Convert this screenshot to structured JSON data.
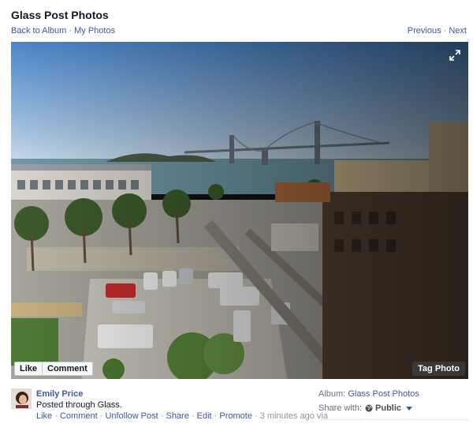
{
  "page": {
    "title": "Glass Post Photos"
  },
  "subnav": {
    "back_label": "Back to Album",
    "separator": " · ",
    "my_photos_label": "My Photos"
  },
  "pager": {
    "previous_label": "Previous",
    "separator": " · ",
    "next_label": "Next"
  },
  "photo": {
    "like_label": "Like",
    "comment_label": "Comment",
    "tag_label": "Tag Photo"
  },
  "post": {
    "author": "Emily Price",
    "text": "Posted through Glass.",
    "actions": {
      "like": "Like",
      "comment": "Comment",
      "unfollow": "Unfollow Post",
      "share": "Share",
      "edit": "Edit",
      "promote": "Promote",
      "time": "3 minutes ago",
      "via": "via",
      "separator": " · "
    }
  },
  "meta": {
    "album_label": "Album:",
    "album_name": "Glass Post Photos",
    "share_label": "Share with:",
    "share_value": "Public"
  },
  "icons": {
    "expand": "expand-icon",
    "globe": "globe-icon",
    "caret": "caret-down-icon"
  }
}
